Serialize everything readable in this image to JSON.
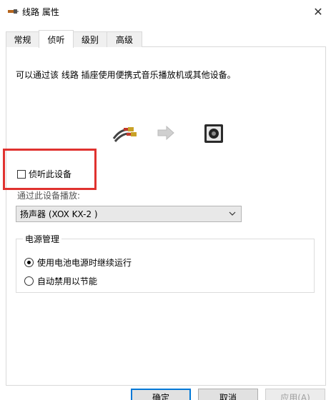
{
  "window": {
    "title": "线路 属性",
    "icon": "speaker-plug-icon",
    "close_glyph": "✕"
  },
  "tabs": [
    {
      "label": "常规"
    },
    {
      "label": "侦听"
    },
    {
      "label": "级别"
    },
    {
      "label": "高级"
    }
  ],
  "active_tab": "侦听",
  "listen": {
    "description": "可以通过该 线路 插座使用便携式音乐播放机或其他设备。",
    "checkbox_label": "侦听此设备",
    "checkbox_checked": false,
    "playback_label": "通过此设备播放:",
    "playback_device": "扬声器 (XOX KX-2 )"
  },
  "power": {
    "group_title": "电源管理",
    "options": [
      {
        "label": "使用电池电源时继续运行",
        "checked": true
      },
      {
        "label": "自动禁用以节能",
        "checked": false
      }
    ]
  },
  "buttons": {
    "ok": "确定",
    "cancel": "取消",
    "apply": "应用(A)"
  },
  "colors": {
    "highlight_box": "#e0322f",
    "primary_border": "#0078d7"
  }
}
